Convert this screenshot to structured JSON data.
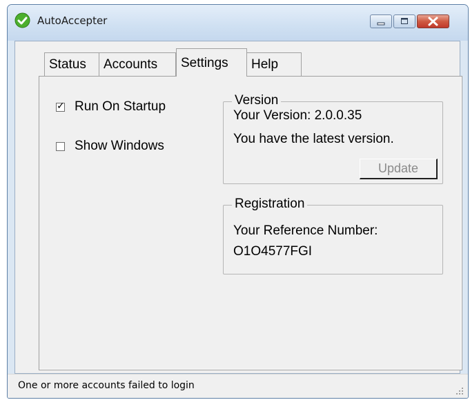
{
  "window": {
    "title": "AutoAccepter"
  },
  "tabs": [
    {
      "label": "Status"
    },
    {
      "label": "Accounts"
    },
    {
      "label": "Settings",
      "selected": true
    },
    {
      "label": "Help"
    }
  ],
  "settings": {
    "run_on_startup": {
      "label": "Run On Startup",
      "checked": true
    },
    "show_windows": {
      "label": "Show Windows",
      "checked": false
    },
    "version": {
      "title": "Version",
      "your_version": "Your Version:  2.0.0.35",
      "status": "You have the latest version.",
      "update_label": "Update"
    },
    "registration": {
      "title": "Registration",
      "ref_label": "Your Reference Number:",
      "ref_number": "O1O4577FGI"
    }
  },
  "statusbar": {
    "text": "One or more accounts failed to login"
  },
  "icons": {
    "app": "green-check-circle-icon",
    "minimize": "minimize-icon",
    "maximize": "maximize-icon",
    "close": "close-icon",
    "grip": "resize-grip-icon"
  },
  "colors": {
    "close_button": "#c0392b",
    "app_icon": "#4caf2e"
  }
}
